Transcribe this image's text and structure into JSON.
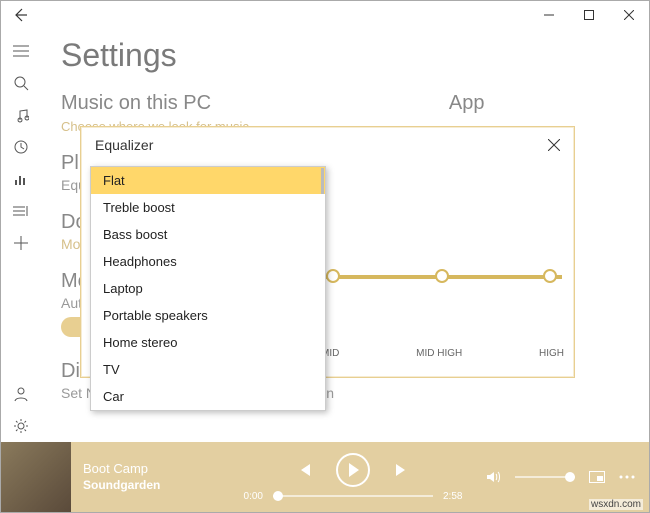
{
  "titlebar": {
    "title": ""
  },
  "page": {
    "title": "Settings"
  },
  "sections": {
    "music": {
      "heading": "Music on this PC",
      "link": "Choose where we look for music"
    },
    "app": {
      "heading": "App"
    },
    "playback": {
      "heading": "Playback",
      "sub": "Equalizer"
    },
    "downloads": {
      "heading": "Downloads",
      "sub": "Mo"
    },
    "media": {
      "heading": "Media Info",
      "sub": "Aut"
    },
    "display": {
      "heading": "Display",
      "sub": "Set Now Playing artist art as my lock screen"
    }
  },
  "dialog": {
    "title": "Equalizer",
    "bands": [
      "MID",
      "MID HIGH",
      "HIGH"
    ]
  },
  "dropdown": {
    "items": [
      "Flat",
      "Treble boost",
      "Bass boost",
      "Headphones",
      "Laptop",
      "Portable speakers",
      "Home stereo",
      "TV",
      "Car"
    ],
    "selected": "Flat"
  },
  "player": {
    "track": "Boot Camp",
    "artist": "Soundgarden",
    "elapsed": "0:00",
    "total": "2:58"
  },
  "watermark": "wsxdn.com"
}
